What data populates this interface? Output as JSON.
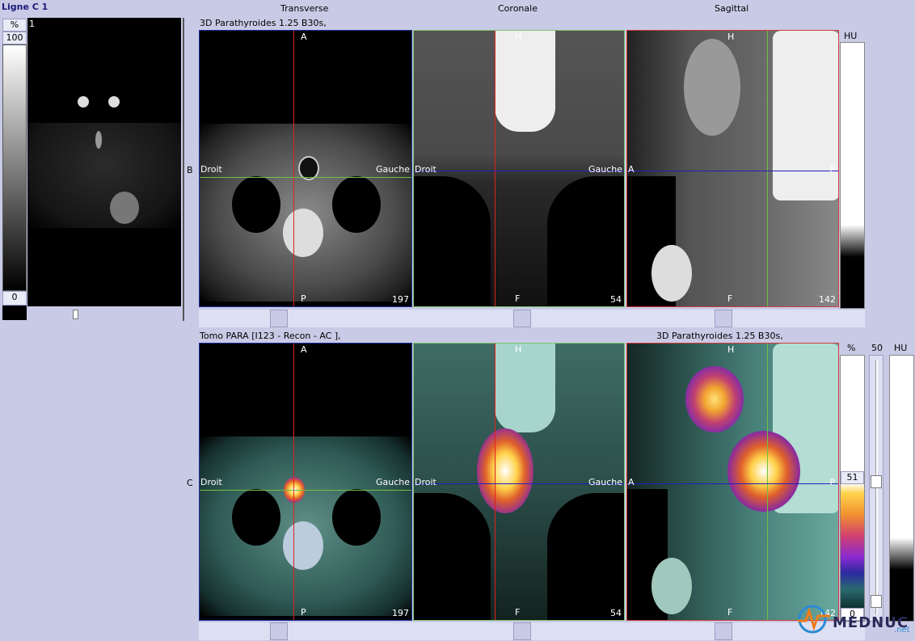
{
  "title": "Ligne C 1",
  "view_headers": [
    "Transverse",
    "Coronale",
    "Sagittal"
  ],
  "left_panel": {
    "percent_label": "%",
    "scale_top": "100",
    "scale_bottom": "0",
    "image_index": "1"
  },
  "top_row": {
    "row_letter": "B",
    "series_label": "3D Parathyroides  1.25  B30s,",
    "hu_label": "HU",
    "views": [
      {
        "top": "A",
        "bottom": "P",
        "left": "Droit",
        "right": "Gauche",
        "slice": "197"
      },
      {
        "top": "H",
        "bottom": "F",
        "left": "Droit",
        "right": "Gauche",
        "slice": "54"
      },
      {
        "top": "H",
        "bottom": "F",
        "left": "A",
        "right": "P",
        "slice": "142"
      }
    ]
  },
  "bottom_row": {
    "row_letter": "C",
    "series_label_left": "Tomo PARA [I123 - Recon - AC ],",
    "series_label_right": "3D Parathyroides  1.25  B30s,",
    "percent_label": "%",
    "value_50": "50",
    "hu_label": "HU",
    "value_51": "51",
    "value_0": "0",
    "views": [
      {
        "top": "A",
        "bottom": "P",
        "left": "Droit",
        "right": "Gauche",
        "slice": "197"
      },
      {
        "top": "H",
        "bottom": "F",
        "left": "Droit",
        "right": "Gauche",
        "slice": "54"
      },
      {
        "top": "H",
        "bottom": "F",
        "left": "A",
        "right": "P",
        "slice": "142"
      }
    ]
  },
  "watermark": {
    "brand": "MEDNUC",
    "suffix": ".net"
  },
  "colors": {
    "transverse_frame": "#1f2f9a",
    "coronal_frame": "#7ec36a",
    "sagittal_frame": "#d23a3a",
    "crosshair_red": "#e02020",
    "crosshair_green": "#70c040",
    "crosshair_blue": "#2020c0"
  }
}
